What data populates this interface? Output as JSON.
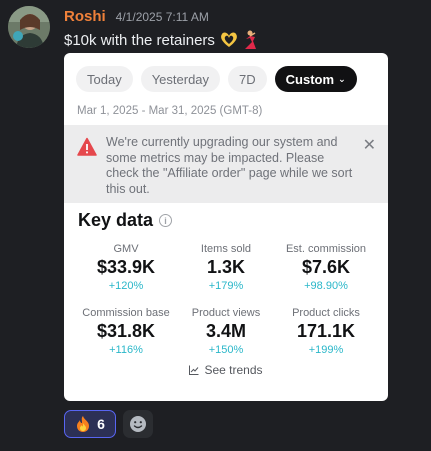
{
  "message": {
    "username": "Roshi",
    "timestamp": "4/1/2025 7:11 AM",
    "text": "$10k with the retainers",
    "emojis": [
      "heart-hands-emoji",
      "dancer-emoji"
    ],
    "avatar_icon": "user-avatar"
  },
  "embed": {
    "tabs": [
      {
        "label": "Today"
      },
      {
        "label": "Yesterday"
      },
      {
        "label": "7D"
      },
      {
        "label": "Custom"
      }
    ],
    "active_tab": "Custom",
    "date_range": "Mar 1, 2025 - Mar 31, 2025 (GMT-8)",
    "banner": {
      "text": "We're currently upgrading our system and some metrics may be impacted. Please check the \"Affiliate order\" page while we sort this out.",
      "icon": "warning-icon",
      "close_icon": "close-icon"
    },
    "key_data_title": "Key data",
    "metrics": [
      {
        "label": "GMV",
        "value": "$33.9K",
        "delta": "+120%"
      },
      {
        "label": "Items sold",
        "value": "1.3K",
        "delta": "+179%"
      },
      {
        "label": "Est. commission",
        "value": "$7.6K",
        "delta": "+98.90%"
      },
      {
        "label": "Commission base",
        "value": "$31.8K",
        "delta": "+116%"
      },
      {
        "label": "Product views",
        "value": "3.4M",
        "delta": "+150%"
      },
      {
        "label": "Product clicks",
        "value": "171.1K",
        "delta": "+199%"
      }
    ],
    "see_trends": "See trends"
  },
  "reactions": [
    {
      "emoji": "fire-emoji",
      "count": "6",
      "active": true
    }
  ],
  "colors": {
    "background": "#1e1f23",
    "username": "#f0813a",
    "delta": "#2ab7c9",
    "reaction_border": "#5865f2"
  }
}
